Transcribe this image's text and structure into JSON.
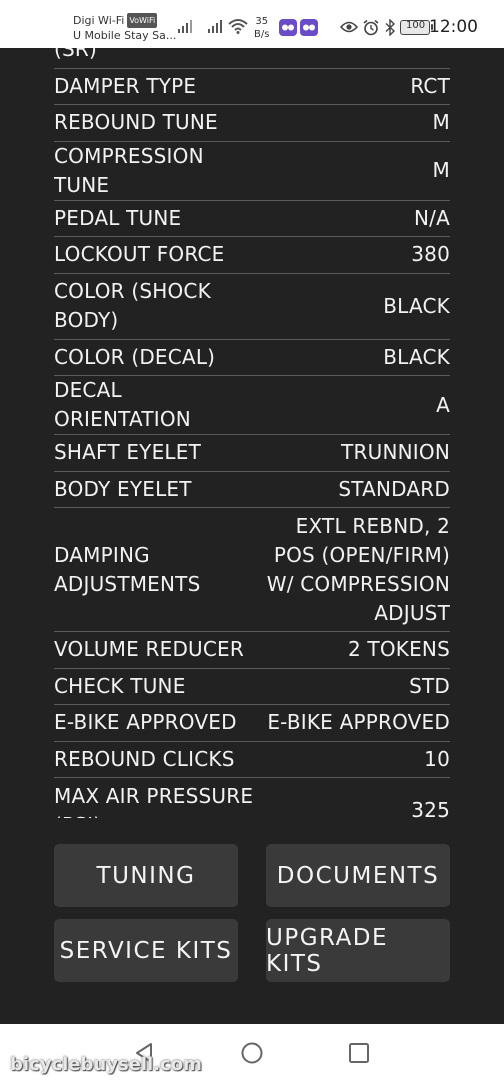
{
  "status_bar": {
    "carrier_line1": "Digi Wi-Fi",
    "volte_badge": "VoWiFi",
    "carrier_line2": "U Mobile Stay Sa...",
    "net_speed_value": "35",
    "net_speed_unit": "B/s",
    "battery": "100",
    "time": "12:00"
  },
  "specs": [
    {
      "label": "(SR)",
      "value": ""
    },
    {
      "label": "DAMPER TYPE",
      "value": "RCT"
    },
    {
      "label": "REBOUND TUNE",
      "value": "M"
    },
    {
      "label": "COMPRESSION TUNE",
      "value": "M"
    },
    {
      "label": "PEDAL TUNE",
      "value": "N/A"
    },
    {
      "label": "LOCKOUT FORCE",
      "value": "380"
    },
    {
      "label": "COLOR (SHOCK BODY)",
      "value": "BLACK"
    },
    {
      "label": "COLOR (DECAL)",
      "value": "BLACK"
    },
    {
      "label": "DECAL ORIENTATION",
      "value": "A"
    },
    {
      "label": "SHAFT EYELET",
      "value": "TRUNNION"
    },
    {
      "label": "BODY EYELET",
      "value": "STANDARD"
    },
    {
      "label": "DAMPING ADJUSTMENTS",
      "value": "EXTL REBND, 2 POS (OPEN/FIRM) W/ COMPRESSION ADJUST"
    },
    {
      "label": "VOLUME REDUCER",
      "value": "2 TOKENS"
    },
    {
      "label": "CHECK TUNE",
      "value": "STD"
    },
    {
      "label": "E-BIKE APPROVED",
      "value": "E-BIKE APPROVED"
    },
    {
      "label": "REBOUND CLICKS",
      "value": "10"
    },
    {
      "label": "MAX AIR PRESSURE (PSI)",
      "value": "325"
    }
  ],
  "buttons": {
    "tuning": "TUNING",
    "documents": "DOCUMENTS",
    "service_kits": "SERVICE KITS",
    "upgrade_kits": "UPGRADE KITS"
  },
  "watermark": "bicyclebuysell.com",
  "colors": {
    "background": "#222222",
    "button": "#3a3a3a",
    "divider": "#5a5a5a",
    "status_bar": "#ffffff",
    "app_badge": "#6a4cc9"
  },
  "icons": [
    "signal-icon",
    "wifi-icon",
    "app-badge-icon",
    "eye-icon",
    "alarm-icon",
    "bluetooth-icon",
    "battery-icon",
    "back-icon",
    "home-icon",
    "recents-icon"
  ]
}
